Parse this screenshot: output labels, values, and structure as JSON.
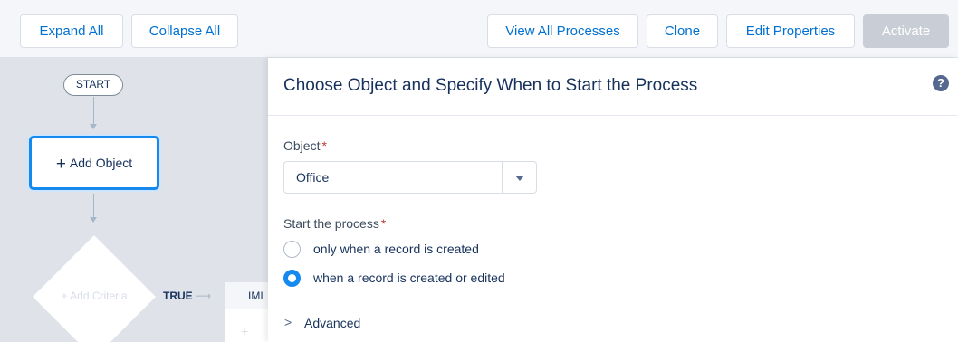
{
  "toolbar": {
    "expand_all": "Expand All",
    "collapse_all": "Collapse All",
    "view_all_processes": "View All Processes",
    "clone": "Clone",
    "edit_properties": "Edit Properties",
    "activate": "Activate"
  },
  "canvas": {
    "start_label": "START",
    "add_object_label": "Add Object",
    "add_criteria_label": "Add Criteria",
    "true_label": "TRUE",
    "immediate_label": "IMI"
  },
  "panel": {
    "title": "Choose Object and Specify When to Start the Process",
    "help_icon": "question-circle-icon",
    "object_label": "Object",
    "object_value": "Office",
    "start_label": "Start the process",
    "options": [
      {
        "label": "only when a record is created",
        "checked": false
      },
      {
        "label": "when a record is created or edited",
        "checked": true
      }
    ],
    "advanced_label": "Advanced"
  },
  "colors": {
    "brand_blue": "#0070d2",
    "selected_blue": "#1589ee",
    "text_navy": "#16325c",
    "canvas_bg": "#dfe3e9",
    "required_red": "#c23934"
  }
}
